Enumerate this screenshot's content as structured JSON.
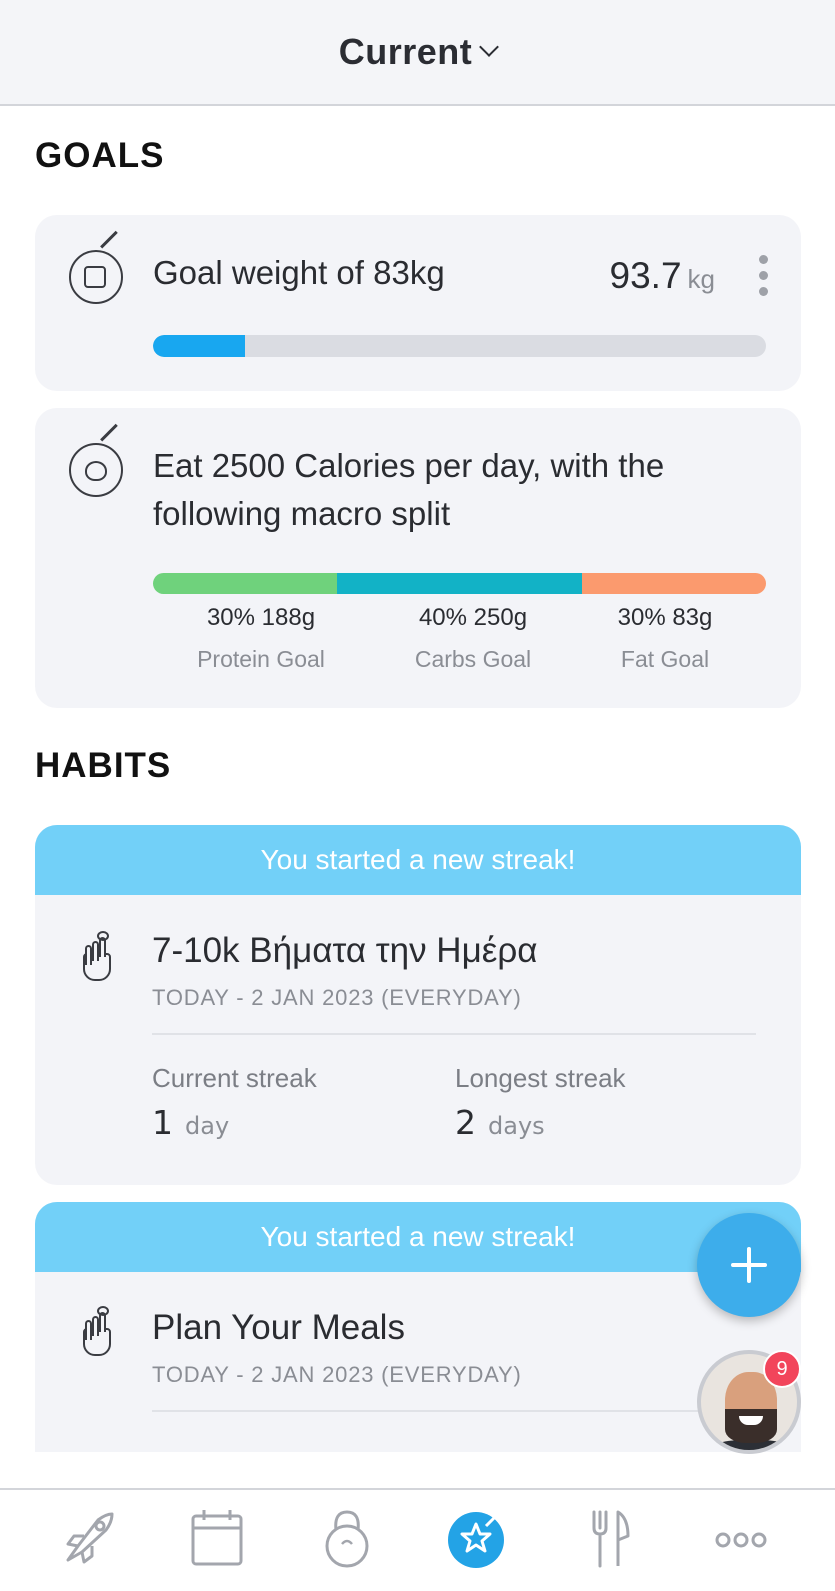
{
  "header": {
    "title": "Current"
  },
  "goals": {
    "section_title": "GOALS",
    "weight_goal": {
      "text": "Goal weight of 83kg",
      "current_value": "93.7",
      "unit": "kg",
      "progress_fraction": 0.15
    },
    "calorie_goal": {
      "text_line1": "Eat 2500 Calories per day, with the",
      "text_line2": "following macro split",
      "macros": [
        {
          "amount": "30% 188g",
          "label": "Protein Goal",
          "fraction": 0.3,
          "color": "#6fd27c"
        },
        {
          "amount": "40% 250g",
          "label": "Carbs Goal",
          "fraction": 0.4,
          "color": "#12b2c6"
        },
        {
          "amount": "30% 83g",
          "label": "Fat Goal",
          "fraction": 0.3,
          "color": "#fb9a6e"
        }
      ]
    }
  },
  "habits": {
    "section_title": "HABITS",
    "items": [
      {
        "banner": "You started a new streak!",
        "title": "7-10k Βήματα την Ημέρα",
        "subtitle": "TODAY - 2 JAN 2023 (EVERYDAY)",
        "current_label": "Current streak",
        "current_value": "1",
        "current_unit": "day",
        "longest_label": "Longest streak",
        "longest_value": "2",
        "longest_unit": "days"
      },
      {
        "banner": "You started a new streak!",
        "title": "Plan Your Meals",
        "subtitle": "TODAY - 2 JAN 2023 (EVERYDAY)"
      }
    ]
  },
  "chat": {
    "unread_count": "9"
  },
  "tabs": [
    {
      "name": "rocket-icon",
      "active": false
    },
    {
      "name": "calendar-icon",
      "active": false
    },
    {
      "name": "kettlebell-icon",
      "active": false
    },
    {
      "name": "goals-star-icon",
      "active": true
    },
    {
      "name": "fork-knife-icon",
      "active": false
    },
    {
      "name": "more-dots-icon",
      "active": false
    }
  ],
  "colors": {
    "accent": "#23a3e6",
    "banner": "#72d0f8",
    "progress": "#18a7f0"
  }
}
